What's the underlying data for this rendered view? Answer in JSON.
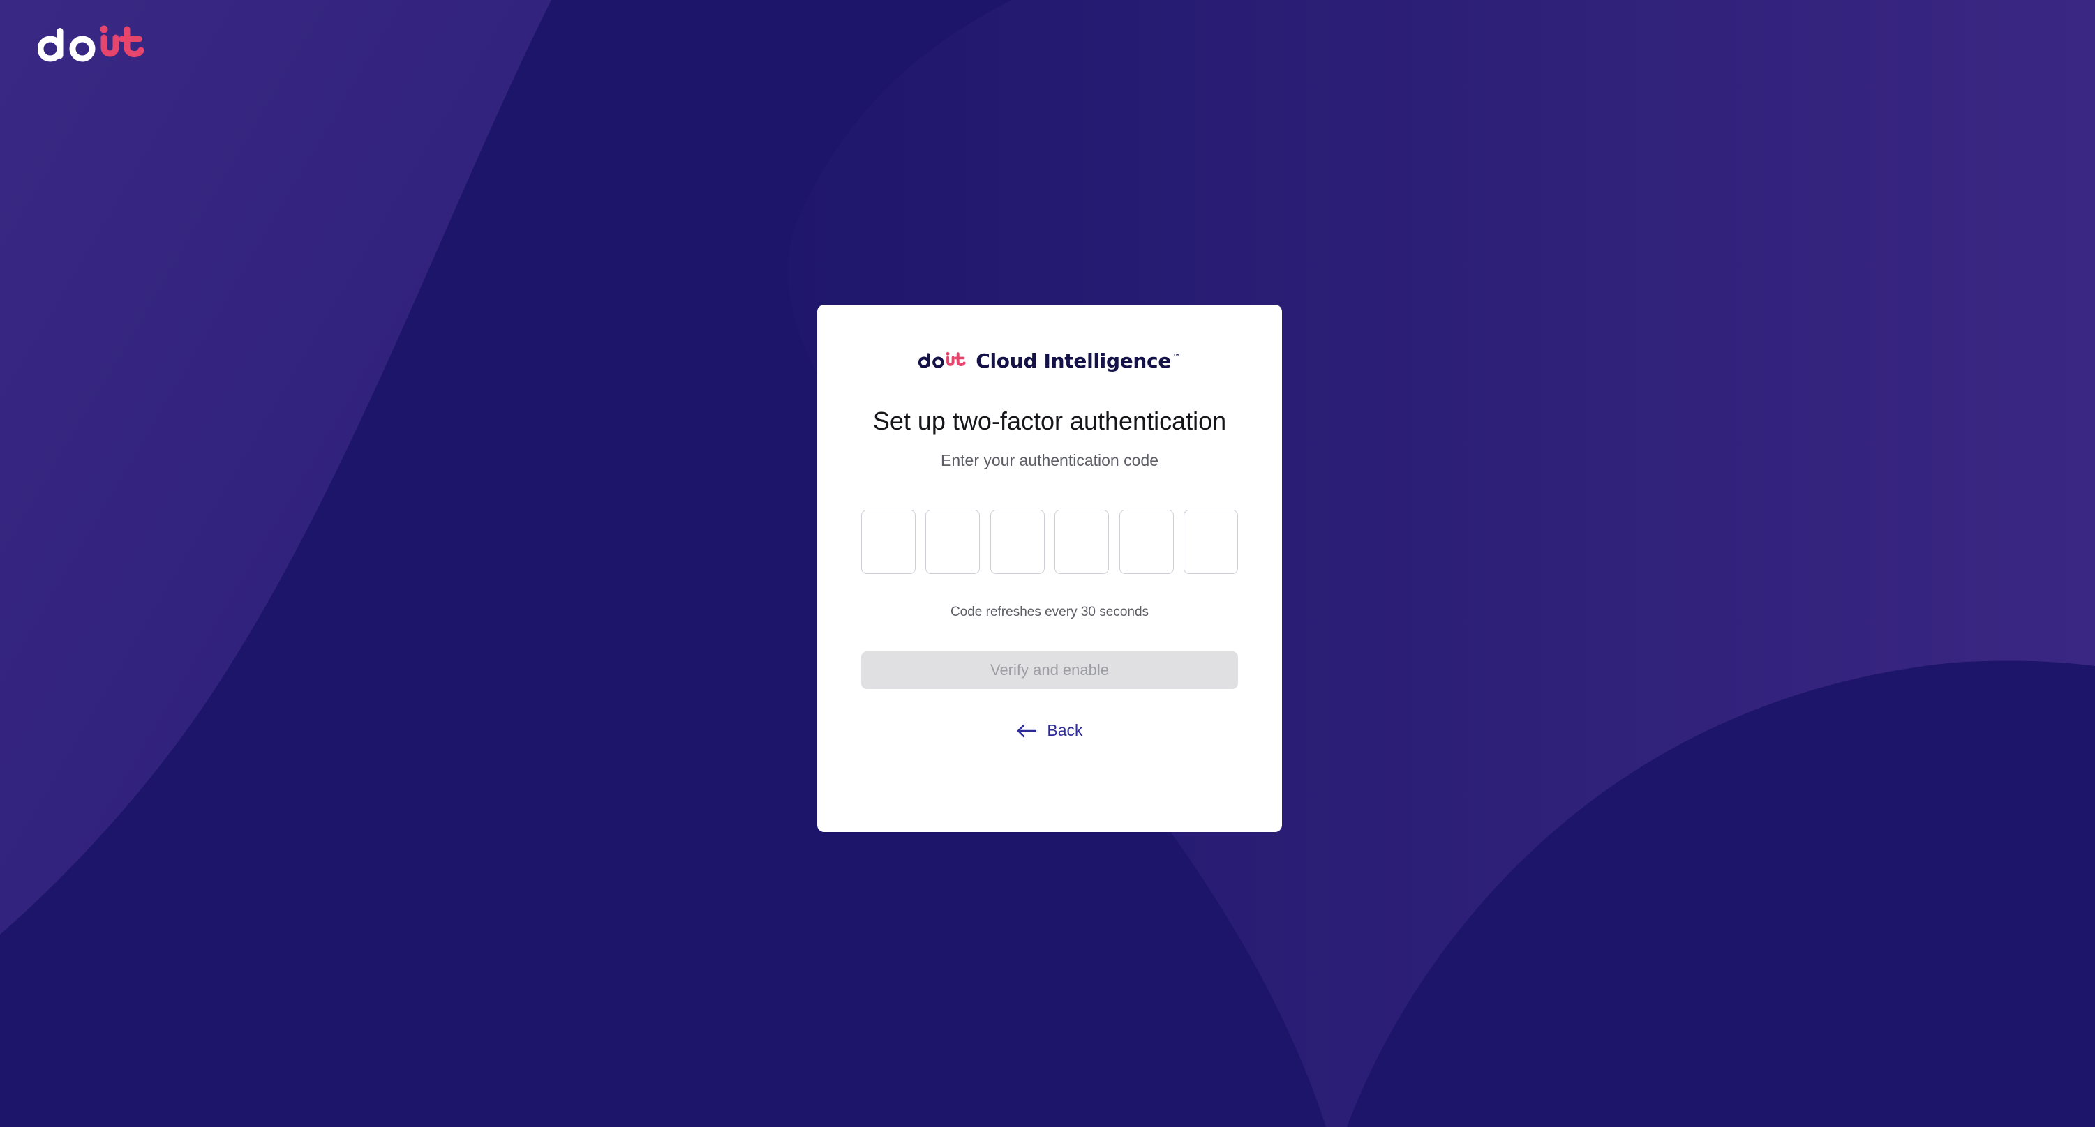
{
  "brand": {
    "name": "Cloud Intelligence",
    "trademark": "™",
    "logo_icon": "doit-logo-icon",
    "logo_colors": {
      "do": "#ffffff",
      "it": "#e8456d",
      "do_dark": "#141247"
    }
  },
  "page": {
    "background_color": "#1c1569",
    "accent_color": "#2c2a97"
  },
  "form": {
    "title": "Set up two-factor authentication",
    "subtitle": "Enter your authentication code",
    "code_digits": [
      "",
      "",
      "",
      "",
      "",
      ""
    ],
    "hint": "Code refreshes every 30 seconds",
    "verify_label": "Verify and enable",
    "verify_enabled": false,
    "back_label": "Back",
    "back_icon": "arrow-left-icon"
  }
}
